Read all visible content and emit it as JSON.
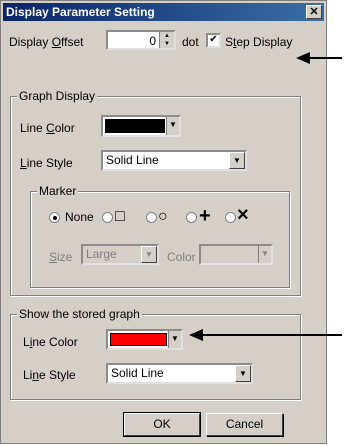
{
  "window": {
    "title": "Display Parameter Setting",
    "close_glyph": "✕"
  },
  "offset": {
    "label_pre": "Display ",
    "label_acc": "O",
    "label_post": "ffset",
    "value": "0",
    "unit": "dot"
  },
  "step_display": {
    "checked": true,
    "check_glyph": "✔",
    "label_pre": "S",
    "label_acc": "t",
    "label_post": "ep Display"
  },
  "graph_display": {
    "legend": "Graph Display",
    "line_color_label_pre": "Line ",
    "line_color_label_acc": "C",
    "line_color_label_post": "olor",
    "line_color_hex": "#000000",
    "line_style_label_acc": "L",
    "line_style_label_post": "ine Style",
    "line_style_value": "Solid Line",
    "marker": {
      "legend": "Marker",
      "options": [
        {
          "label": "None",
          "selected": true
        },
        {
          "symbol": "□",
          "selected": false
        },
        {
          "symbol": "○",
          "selected": false
        },
        {
          "symbol": "+",
          "selected": false
        },
        {
          "symbol": "×",
          "selected": false
        }
      ],
      "size_label_acc": "S",
      "size_label_post": "ize",
      "size_value": "Large",
      "color_label": "Color"
    }
  },
  "stored_graph": {
    "legend": "Show the stored graph",
    "line_color_label_pre": "L",
    "line_color_label_acc": "i",
    "line_color_label_post": "ne Color",
    "line_color_hex": "#ff0000",
    "line_style_label_pre": "Li",
    "line_style_label_acc": "n",
    "line_style_label_post": "e Style",
    "line_style_value": "Solid Line"
  },
  "buttons": {
    "ok": "OK",
    "cancel": "Cancel"
  },
  "glyphs": {
    "dropdown": "▼",
    "spin_up": "▲",
    "spin_down": "▼"
  }
}
